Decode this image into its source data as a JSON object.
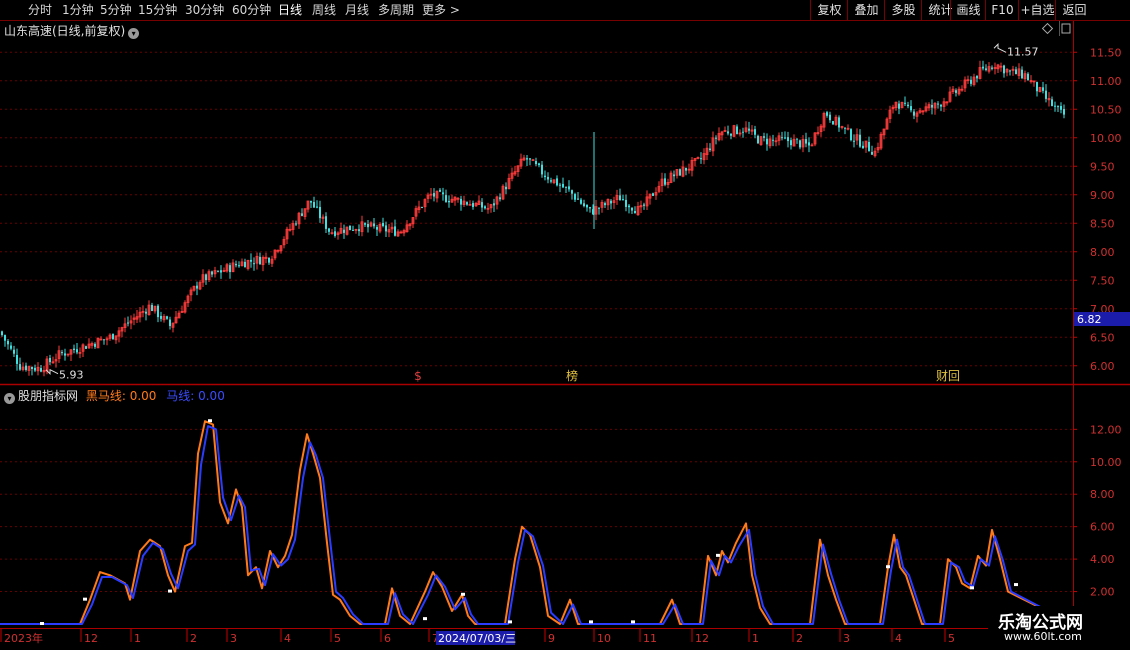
{
  "toolbar": {
    "periods": [
      "分时",
      "1分钟",
      "5分钟",
      "15分钟",
      "30分钟",
      "60分钟",
      "日线",
      "周线",
      "月线",
      "多周期",
      "更多 >"
    ],
    "active_period": "日线",
    "right_buttons": [
      "复权",
      "叠加",
      "多股",
      "统计",
      "画线",
      "F10",
      "+自选",
      "返回"
    ]
  },
  "stock": {
    "title": "山东高速(日线,前复权)",
    "high_label": "11.57",
    "low_label": "5.93",
    "current_price": "6.82",
    "markers": [
      {
        "text": "$",
        "color": "#e04040"
      },
      {
        "text": "榜",
        "color": "#e0c040"
      },
      {
        "text": "财回",
        "color": "#e0c040"
      }
    ]
  },
  "indicator": {
    "name": "股朋指标网",
    "line1_label": "黑马线: 0.00",
    "line2_label": "马线: 0.00",
    "line1_color": "#ff7a1a",
    "line2_color": "#2a3cff"
  },
  "price_axis": {
    "ticks": [
      "11.50",
      "11.00",
      "10.50",
      "10.00",
      "9.50",
      "9.00",
      "8.50",
      "8.00",
      "7.50",
      "7.00",
      "6.50",
      "6.00"
    ]
  },
  "indicator_axis": {
    "ticks": [
      "12.00",
      "10.00",
      "8.00",
      "6.00",
      "4.00",
      "2.00"
    ]
  },
  "time_axis": {
    "labels": [
      "2023年",
      "12",
      "1",
      "2",
      "3",
      "4",
      "5",
      "6",
      "7",
      "2024/07/03/三",
      "9",
      "10",
      "11",
      "12",
      "1",
      "2",
      "3",
      "4",
      "5"
    ]
  },
  "watermark": {
    "name": "乐淘公式网",
    "url": "www.60lt.com"
  },
  "chart_data": {
    "type": "candlestick+line",
    "price": {
      "ylim": [
        5.75,
        11.75
      ],
      "keypoints": [
        [
          0,
          6.6
        ],
        [
          20,
          6.0
        ],
        [
          40,
          5.95
        ],
        [
          60,
          6.2
        ],
        [
          110,
          6.5
        ],
        [
          150,
          7.05
        ],
        [
          170,
          6.7
        ],
        [
          200,
          7.5
        ],
        [
          240,
          7.8
        ],
        [
          270,
          7.9
        ],
        [
          310,
          8.9
        ],
        [
          330,
          8.35
        ],
        [
          360,
          8.45
        ],
        [
          400,
          8.35
        ],
        [
          430,
          9.0
        ],
        [
          460,
          8.9
        ],
        [
          490,
          8.75
        ],
        [
          525,
          9.65
        ],
        [
          545,
          9.35
        ],
        [
          570,
          9.05
        ],
        [
          590,
          8.7
        ],
        [
          620,
          8.95
        ],
        [
          640,
          8.7
        ],
        [
          660,
          9.2
        ],
        [
          700,
          9.6
        ],
        [
          720,
          10.1
        ],
        [
          745,
          10.15
        ],
        [
          760,
          9.95
        ],
        [
          790,
          9.95
        ],
        [
          810,
          9.85
        ],
        [
          825,
          10.45
        ],
        [
          850,
          10.05
        ],
        [
          875,
          9.75
        ],
        [
          895,
          10.65
        ],
        [
          910,
          10.45
        ],
        [
          935,
          10.55
        ],
        [
          960,
          10.85
        ],
        [
          980,
          11.15
        ],
        [
          995,
          11.3
        ],
        [
          1010,
          11.15
        ],
        [
          1025,
          11.1
        ],
        [
          1045,
          10.7
        ],
        [
          1062,
          10.4
        ]
      ],
      "marked_high": 11.57,
      "marked_low": 5.93,
      "current": 6.82
    },
    "indicator": {
      "ylim": [
        0,
        13.5
      ],
      "series": [
        {
          "name": "黑马线",
          "color": "#ff7a1a",
          "points": [
            [
              0,
              0
            ],
            [
              80,
              0
            ],
            [
              90,
              1.5
            ],
            [
              100,
              3.2
            ],
            [
              110,
              3.0
            ],
            [
              125,
              2.5
            ],
            [
              130,
              1.5
            ],
            [
              140,
              4.5
            ],
            [
              150,
              5.2
            ],
            [
              160,
              4.8
            ],
            [
              168,
              3.0
            ],
            [
              175,
              2.0
            ],
            [
              185,
              4.8
            ],
            [
              192,
              5.0
            ],
            [
              198,
              10.5
            ],
            [
              205,
              12.5
            ],
            [
              213,
              12.3
            ],
            [
              220,
              7.5
            ],
            [
              228,
              6.2
            ],
            [
              236,
              8.3
            ],
            [
              242,
              7.2
            ],
            [
              248,
              3.0
            ],
            [
              256,
              3.5
            ],
            [
              262,
              2.2
            ],
            [
              270,
              4.5
            ],
            [
              278,
              3.5
            ],
            [
              285,
              4.2
            ],
            [
              292,
              5.5
            ],
            [
              300,
              9.5
            ],
            [
              307,
              11.7
            ],
            [
              313,
              10.5
            ],
            [
              320,
              9.0
            ],
            [
              327,
              5.0
            ],
            [
              333,
              1.8
            ],
            [
              340,
              1.5
            ],
            [
              350,
              0.5
            ],
            [
              360,
              0
            ],
            [
              385,
              0
            ],
            [
              392,
              2.2
            ],
            [
              400,
              0.5
            ],
            [
              410,
              0
            ],
            [
              425,
              2.0
            ],
            [
              433,
              3.2
            ],
            [
              442,
              2.3
            ],
            [
              452,
              0.8
            ],
            [
              462,
              1.8
            ],
            [
              468,
              0.5
            ],
            [
              475,
              0
            ],
            [
              505,
              0
            ],
            [
              515,
              4.0
            ],
            [
              522,
              6.0
            ],
            [
              530,
              5.5
            ],
            [
              540,
              3.5
            ],
            [
              548,
              0.5
            ],
            [
              560,
              0
            ],
            [
              570,
              1.5
            ],
            [
              578,
              0
            ],
            [
              660,
              0
            ],
            [
              672,
              1.5
            ],
            [
              680,
              0
            ],
            [
              700,
              0
            ],
            [
              708,
              4.2
            ],
            [
              716,
              3.0
            ],
            [
              722,
              4.5
            ],
            [
              728,
              3.8
            ],
            [
              736,
              5.0
            ],
            [
              746,
              6.2
            ],
            [
              752,
              3.0
            ],
            [
              760,
              1.0
            ],
            [
              770,
              0
            ],
            [
              810,
              0
            ],
            [
              820,
              5.2
            ],
            [
              828,
              3.0
            ],
            [
              836,
              1.5
            ],
            [
              845,
              0
            ],
            [
              880,
              0
            ],
            [
              888,
              3.5
            ],
            [
              894,
              5.5
            ],
            [
              900,
              3.5
            ],
            [
              906,
              3.0
            ],
            [
              914,
              1.5
            ],
            [
              922,
              0
            ],
            [
              940,
              0
            ],
            [
              948,
              4.0
            ],
            [
              956,
              3.5
            ],
            [
              962,
              2.5
            ],
            [
              970,
              2.2
            ],
            [
              978,
              4.2
            ],
            [
              986,
              3.6
            ],
            [
              992,
              5.8
            ],
            [
              1000,
              4.0
            ],
            [
              1008,
              2.0
            ]
          ]
        },
        {
          "name": "马线",
          "color": "#2a3cff",
          "points": [
            [
              0,
              0
            ],
            [
              82,
              0
            ],
            [
              92,
              1.2
            ],
            [
              102,
              2.9
            ],
            [
              112,
              2.9
            ],
            [
              127,
              2.4
            ],
            [
              133,
              1.6
            ],
            [
              143,
              4.2
            ],
            [
              153,
              5.0
            ],
            [
              163,
              4.6
            ],
            [
              171,
              3.1
            ],
            [
              178,
              2.2
            ],
            [
              188,
              4.5
            ],
            [
              195,
              4.9
            ],
            [
              201,
              9.8
            ],
            [
              208,
              12.2
            ],
            [
              216,
              12.0
            ],
            [
              223,
              7.8
            ],
            [
              231,
              6.4
            ],
            [
              239,
              7.9
            ],
            [
              245,
              7.2
            ],
            [
              251,
              3.3
            ],
            [
              259,
              3.4
            ],
            [
              265,
              2.4
            ],
            [
              273,
              4.3
            ],
            [
              281,
              3.6
            ],
            [
              288,
              4.0
            ],
            [
              295,
              5.2
            ],
            [
              303,
              9.0
            ],
            [
              310,
              11.2
            ],
            [
              316,
              10.4
            ],
            [
              323,
              9.0
            ],
            [
              330,
              5.2
            ],
            [
              336,
              2.0
            ],
            [
              343,
              1.6
            ],
            [
              353,
              0.6
            ],
            [
              363,
              0
            ],
            [
              388,
              0
            ],
            [
              395,
              1.9
            ],
            [
              403,
              0.6
            ],
            [
              413,
              0
            ],
            [
              428,
              1.8
            ],
            [
              436,
              3.0
            ],
            [
              445,
              2.3
            ],
            [
              455,
              0.9
            ],
            [
              465,
              1.6
            ],
            [
              471,
              0.6
            ],
            [
              478,
              0
            ],
            [
              508,
              0
            ],
            [
              518,
              3.8
            ],
            [
              525,
              5.8
            ],
            [
              533,
              5.4
            ],
            [
              543,
              3.6
            ],
            [
              551,
              0.7
            ],
            [
              563,
              0
            ],
            [
              573,
              1.2
            ],
            [
              581,
              0
            ],
            [
              663,
              0
            ],
            [
              675,
              1.2
            ],
            [
              683,
              0
            ],
            [
              703,
              0
            ],
            [
              711,
              3.9
            ],
            [
              719,
              3.0
            ],
            [
              725,
              4.2
            ],
            [
              731,
              3.8
            ],
            [
              739,
              4.8
            ],
            [
              749,
              5.8
            ],
            [
              755,
              3.1
            ],
            [
              763,
              1.1
            ],
            [
              773,
              0
            ],
            [
              813,
              0
            ],
            [
              823,
              4.9
            ],
            [
              831,
              3.1
            ],
            [
              839,
              1.5
            ],
            [
              848,
              0
            ],
            [
              883,
              0
            ],
            [
              891,
              3.3
            ],
            [
              897,
              5.2
            ],
            [
              903,
              3.5
            ],
            [
              909,
              3.0
            ],
            [
              917,
              1.5
            ],
            [
              925,
              0
            ],
            [
              943,
              0
            ],
            [
              951,
              3.8
            ],
            [
              959,
              3.5
            ],
            [
              965,
              2.6
            ],
            [
              973,
              2.3
            ],
            [
              981,
              4.0
            ],
            [
              989,
              3.6
            ],
            [
              995,
              5.4
            ],
            [
              1003,
              3.9
            ],
            [
              1011,
              2.0
            ]
          ]
        }
      ]
    }
  }
}
